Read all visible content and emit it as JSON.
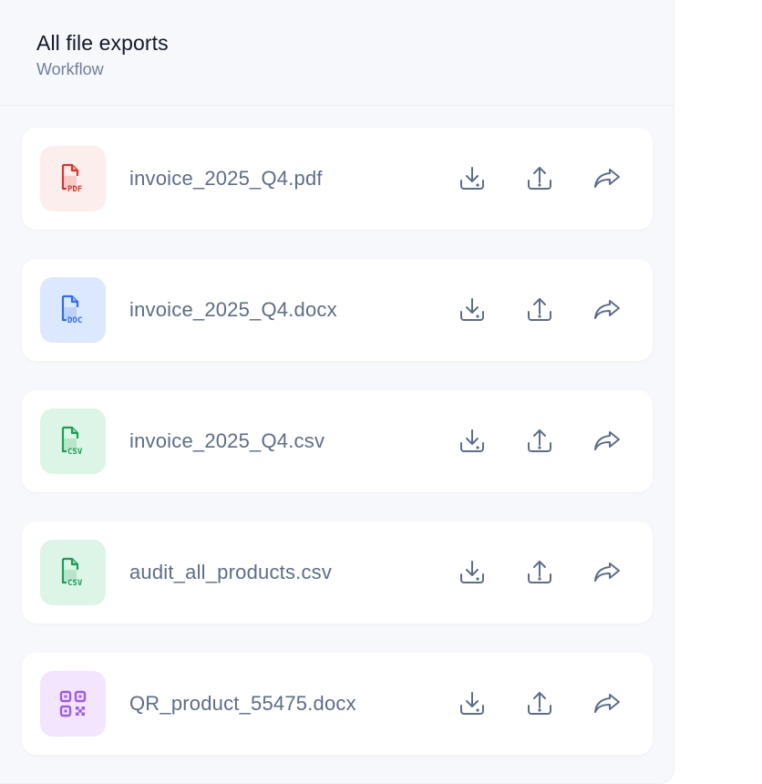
{
  "panel": {
    "title": "All file exports",
    "subtitle": "Workflow"
  },
  "files": [
    {
      "name": "invoice_2025_Q4.pdf",
      "type_label": "PDF",
      "icon": "pdf-file-icon",
      "color": "#d9342b",
      "tile": "#fdeeee"
    },
    {
      "name": "invoice_2025_Q4.docx",
      "type_label": "DOC",
      "icon": "doc-file-icon",
      "color": "#2f6fe4",
      "tile": "#dbe8fd"
    },
    {
      "name": "invoice_2025_Q4.csv",
      "type_label": "CSV",
      "icon": "csv-file-icon",
      "color": "#1f9d55",
      "tile": "#dcf5e6"
    },
    {
      "name": "audit_all_products.csv",
      "type_label": "CSV",
      "icon": "csv-file-icon",
      "color": "#1f9d55",
      "tile": "#dcf5e6"
    },
    {
      "name": "QR_product_55475.docx",
      "type_label": "",
      "icon": "qr-code-icon",
      "color": "#9b5de5",
      "tile": "#f3e5fd"
    }
  ],
  "actions": [
    {
      "name": "download",
      "icon": "download-icon"
    },
    {
      "name": "upload",
      "icon": "upload-icon"
    },
    {
      "name": "share",
      "icon": "share-icon"
    }
  ],
  "colors": {
    "action_icon": "#5d6d88"
  }
}
